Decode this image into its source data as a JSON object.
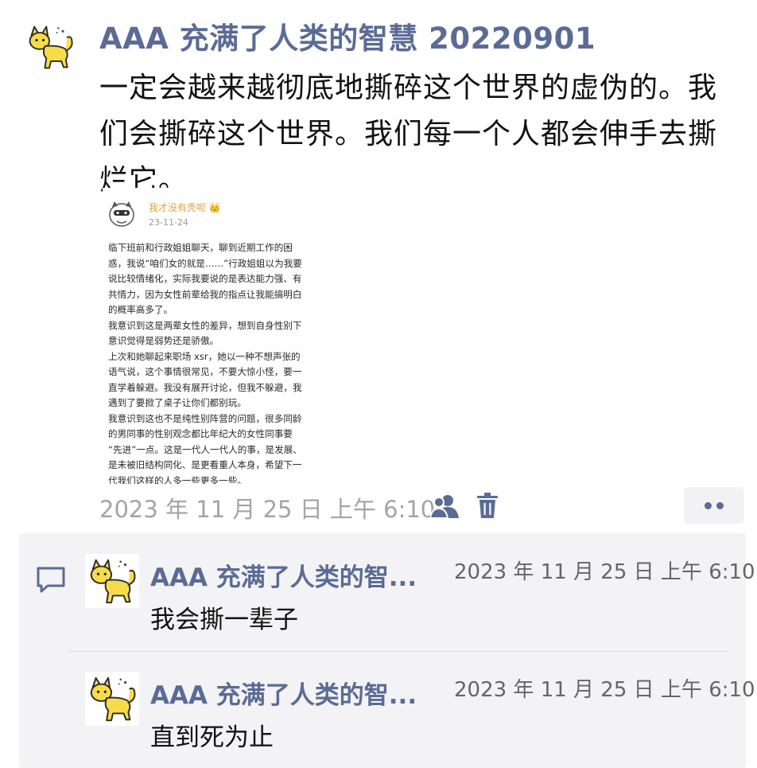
{
  "post": {
    "author": "AAA 充满了人类的智慧 20220901",
    "text": "一定会越来越彻底地撕碎这个世界的虚伪的。我们会撕碎这个世界。我们每一个人都会伸手去撕烂它。",
    "timestamp": "2023 年 11 月 25 日 上午 6:10",
    "avatar_icon": "yellow-cat-icon"
  },
  "attachment": {
    "username": "我才没有秃呢 👑",
    "date": "23-11-24",
    "lines": [
      "临下班前和行政姐姐聊天，聊到近期工作的困",
      "惑，我说“咱们女的就是……”行政姐姐以为我要",
      "说比较情绪化，实际我要说的是表达能力强、有",
      "共情力，因为女性前辈给我的指点让我能搞明白",
      "的概率高多了。",
      "我意识到这是两辈女性的差异，想到自身性别下",
      "意识觉得是弱势还是骄傲。",
      "上次和她聊起来职场 xsr，她以一种不想声张的",
      "语气说，这个事情很常见，不要大惊小怪，要一",
      "直学着躲避。我没有展开讨论，但我不躲避，我",
      "遇到了要掀了桌子让你们都别玩。",
      "我意识到这也不是纯性别阵营的问题，很多同龄",
      "的男同事的性别观念都比年纪大的女性同事要",
      "“先进”一点。这是一代人一代人的事，是发展、",
      "是未被旧结构同化、是更看重人本身，希望下一",
      "代我们这样的人多一些更多一些。"
    ]
  },
  "comments": [
    {
      "author": "AAA 充满了人类的智...",
      "time": "2023 年 11 月 25 日 上午 6:10",
      "text": "我会撕一辈子"
    },
    {
      "author": "AAA 充满了人类的智...",
      "time": "2023 年 11 月 25 日 上午 6:10",
      "text": "直到死为止"
    }
  ],
  "colors": {
    "name_accent": "#5b6b95",
    "timestamp_gray": "#a4a4a4",
    "comment_bg": "#f3f3f5",
    "cat_yellow": "#f7dc4a"
  }
}
